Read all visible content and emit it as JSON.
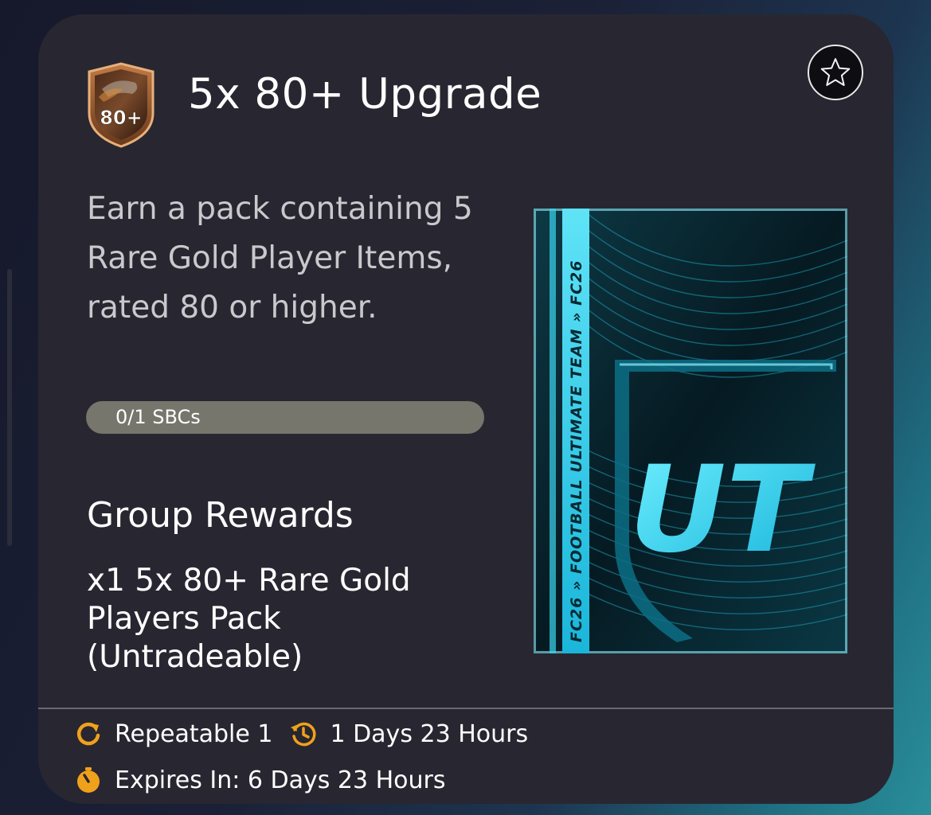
{
  "sbc": {
    "badge_text": "80+",
    "title": "5x 80+ Upgrade",
    "description": "Earn a pack containing 5 Rare Gold Player Items, rated 80 or higher.",
    "progress": {
      "label": "0/1 SBCs",
      "completed": 0,
      "total": 1
    },
    "rewards_heading": "Group Rewards",
    "reward_item": "x1 5x 80+ Rare Gold Players Pack (Untradeable)",
    "pack": {
      "side_text": "FC26 » FOOTBALL ULTIMATE TEAM » FC26",
      "logo_text": "UT"
    },
    "footer": {
      "repeatable": "Repeatable 1",
      "refresh": "1 Days 23 Hours",
      "expires": "Expires In: 6 Days 23 Hours"
    }
  },
  "icons": {
    "badge": "80-plus-badge-icon",
    "favorite": "star-icon",
    "repeat": "repeat-icon",
    "refresh_timer": "history-clock-icon",
    "expiry": "stopwatch-icon"
  },
  "colors": {
    "card_background": "#282731",
    "accent_orange": "#f0a11c",
    "progress_track": "#76766c",
    "pack_cyan": "#21c4e6"
  }
}
